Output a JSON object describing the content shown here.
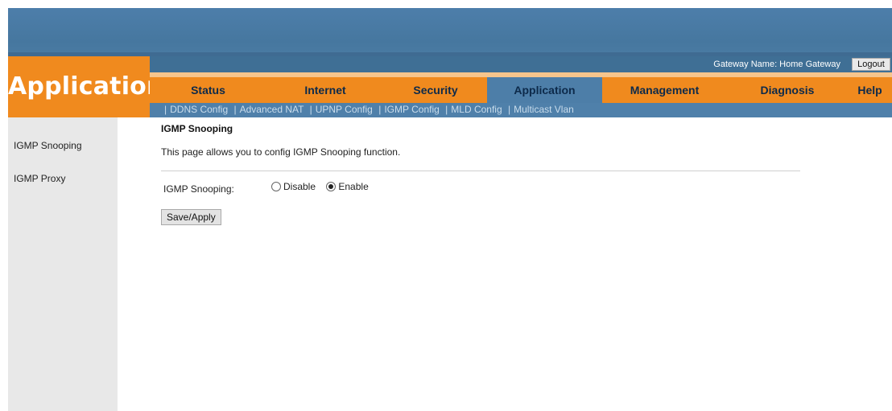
{
  "brand": {
    "title": "Application"
  },
  "header": {
    "gateway_name": "Gateway Name: Home Gateway",
    "logout_label": "Logout"
  },
  "nav": {
    "items": [
      {
        "label": "Status"
      },
      {
        "label": "Internet"
      },
      {
        "label": "Security"
      },
      {
        "label": "Application"
      },
      {
        "label": "Management"
      },
      {
        "label": "Diagnosis"
      },
      {
        "label": "Help"
      }
    ],
    "active": "Application"
  },
  "subnav": {
    "separator": "|",
    "items": [
      {
        "label": "DDNS Config"
      },
      {
        "label": "Advanced NAT"
      },
      {
        "label": "UPNP Config"
      },
      {
        "label": "IGMP Config"
      },
      {
        "label": "MLD Config"
      },
      {
        "label": "Multicast Vlan"
      }
    ]
  },
  "sidebar": {
    "items": [
      {
        "label": "IGMP Snooping"
      },
      {
        "label": "IGMP Proxy"
      }
    ]
  },
  "main": {
    "title": "IGMP Snooping",
    "description": "This page allows you to config IGMP Snooping function.",
    "field_label": "IGMP Snooping:",
    "options": [
      {
        "label": "Disable",
        "checked": false
      },
      {
        "label": "Enable",
        "checked": true
      }
    ],
    "save_label": "Save/Apply"
  },
  "colors": {
    "accent": "#f08a1e",
    "banner": "#4d7eaa",
    "nav_active": "#4d7ea8"
  }
}
